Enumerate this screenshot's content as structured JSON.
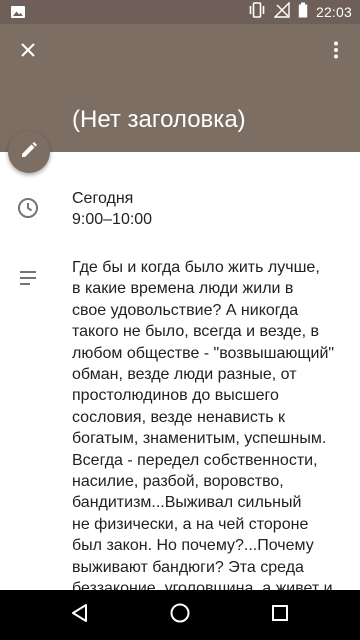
{
  "status_bar": {
    "time": "22:03",
    "icons": [
      "image-icon",
      "vibrate-icon",
      "wifi-off-icon",
      "battery-icon"
    ]
  },
  "app_bar": {
    "title": "(Нет заголовка)",
    "close_icon": "close-icon",
    "overflow_icon": "more-vert-icon",
    "color": "#7d6e64"
  },
  "event": {
    "day": "Сегодня",
    "time_range": "9:00–10:00",
    "description": "Где бы и когда было жить лучше,\nв какие времена люди жили в\nсвое удовольствие? А никогда\nтакого не было, всегда и везде, в\nлюбом обществе - \"возвышающий\"\nобман, везде люди разные, от\nпростолюдинов до высшего\nсословия, везде ненависть к\nбогатым, знаменитым, успешным.\nВсегда - передел собственности,\nнасилие, разбой, воровство,\nбандитизм...Выживал сильный\nне физически, а на чей стороне\nбыл закон. Но почему?...Почему\nвыживают бандюги? Эта среда\nбеззаконие, уголовщина, а живет и\nгубит все..."
  },
  "nav_bar": {
    "buttons": [
      "back-icon",
      "home-icon",
      "recents-icon"
    ]
  }
}
